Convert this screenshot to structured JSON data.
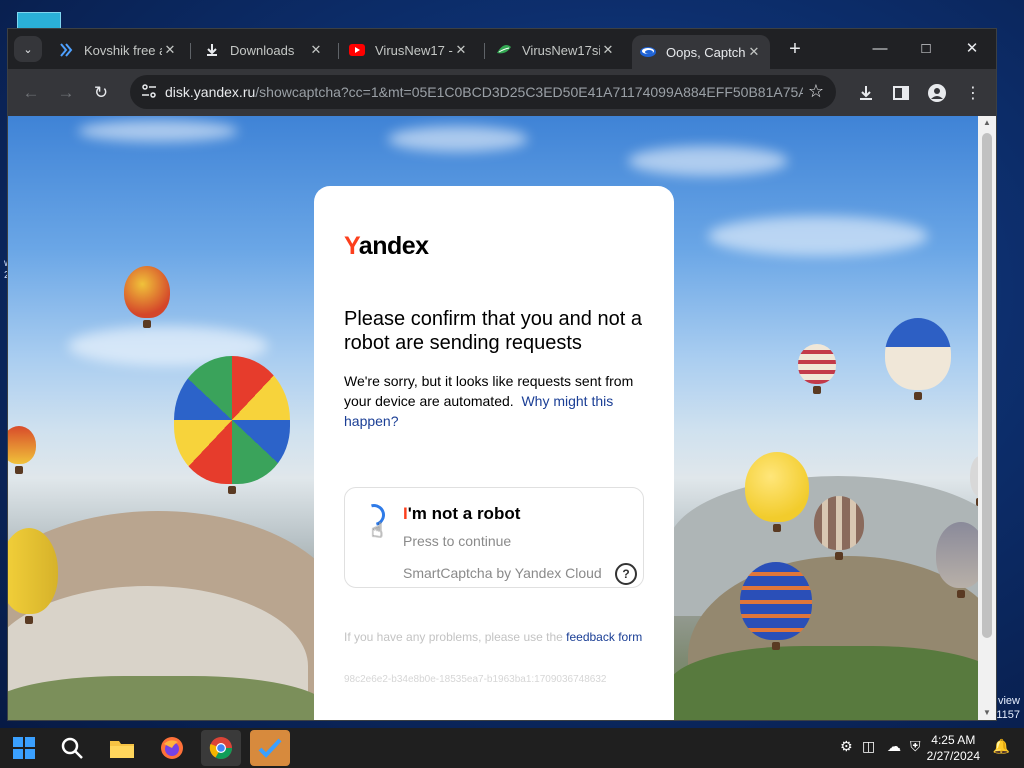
{
  "desktop": {
    "left_text": "w\n2",
    "right_text_1": "view",
    "right_text_2": "1157"
  },
  "tabs": [
    {
      "title": "Kovshik free a",
      "icon": "kovshik-icon",
      "active": false
    },
    {
      "title": "Downloads",
      "icon": "download-icon",
      "active": false
    },
    {
      "title": "VirusNew17 -",
      "icon": "youtube-icon",
      "active": false
    },
    {
      "title": "VirusNew17si",
      "icon": "kovshik-icon",
      "active": false
    },
    {
      "title": "Oops, Captcha",
      "icon": "yandex-disk-icon",
      "active": true
    }
  ],
  "address": {
    "host": "disk.yandex.ru",
    "rest": "/showcaptcha?cc=1&mt=05E1C0BCD3D25C3ED50E41A71174099A884EFF50B81A75AC..."
  },
  "page": {
    "logo_first": "Y",
    "logo_rest": "andex",
    "heading": "Please confirm that you and not a robot are sending requests",
    "desc_text": "We're sorry, but it looks like requests sent from your device are automated.",
    "desc_link": "Why might this happen?",
    "robot_first": "I",
    "robot_rest": "'m not a robot",
    "press": "Press to continue",
    "smartcaptcha": "SmartCaptcha by Yandex Cloud",
    "help": "?",
    "problems_text": "If you have any problems, please use the",
    "problems_link": "feedback form",
    "request_id": "98c2e6e2-b34e8b0e-18535ea7-b1963ba1:1709036748632"
  },
  "taskbar": {
    "apps": [
      "windows-start-icon",
      "search-icon",
      "file-explorer-icon",
      "firefox-icon",
      "chrome-icon",
      "task-app-icon"
    ],
    "time": "4:25 AM",
    "date": "2/27/2024"
  },
  "colors": {
    "yandex_red": "#fc3f1d",
    "link_blue": "#1a3e95",
    "spinner_blue": "#2f7be8"
  }
}
